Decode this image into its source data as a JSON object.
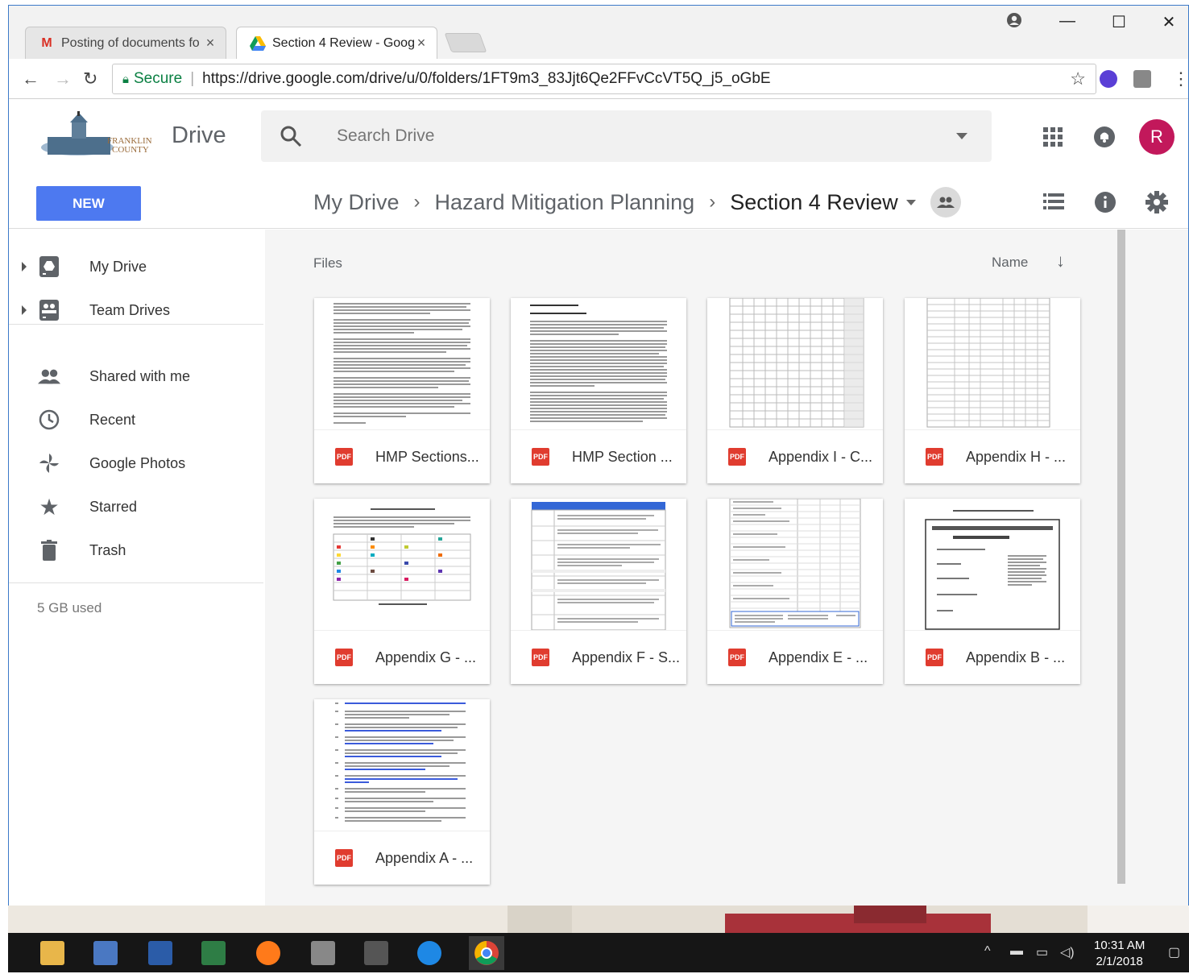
{
  "browser": {
    "tabs": [
      {
        "title": "Posting of documents fo",
        "icon": "gmail-icon"
      },
      {
        "title": "Section 4 Review - Goog",
        "icon": "google-drive-icon"
      }
    ],
    "secure_label": "Secure",
    "url": "https://drive.google.com/drive/u/0/folders/1FT9m3_83Jjt6Qe2FFvCcVT5Q_j5_oGbE"
  },
  "header": {
    "app_name": "Drive",
    "search_placeholder": "Search Drive",
    "avatar_initial": "R",
    "new_button": "NEW"
  },
  "breadcrumb": {
    "items": [
      "My Drive",
      "Hazard Mitigation Planning"
    ],
    "current": "Section 4 Review"
  },
  "sidebar": {
    "items": [
      {
        "label": "My Drive",
        "icon": "my-drive-icon"
      },
      {
        "label": "Team Drives",
        "icon": "team-drives-icon"
      },
      {
        "label": "Shared with me",
        "icon": "people-icon"
      },
      {
        "label": "Recent",
        "icon": "clock-icon"
      },
      {
        "label": "Google Photos",
        "icon": "pinwheel-icon"
      },
      {
        "label": "Starred",
        "icon": "star-icon"
      },
      {
        "label": "Trash",
        "icon": "trash-icon"
      }
    ],
    "storage": "5 GB used"
  },
  "main": {
    "section_title": "Files",
    "sort_label": "Name",
    "files": [
      {
        "name": "HMP Sections...",
        "type": "PDF"
      },
      {
        "name": "HMP Section ...",
        "type": "PDF"
      },
      {
        "name": "Appendix I - C...",
        "type": "PDF"
      },
      {
        "name": "Appendix H - ...",
        "type": "PDF"
      },
      {
        "name": "Appendix G - ...",
        "type": "PDF"
      },
      {
        "name": "Appendix F - S...",
        "type": "PDF"
      },
      {
        "name": "Appendix E - ...",
        "type": "PDF"
      },
      {
        "name": "Appendix B - ...",
        "type": "PDF"
      },
      {
        "name": "Appendix A - ...",
        "type": "PDF"
      }
    ]
  },
  "taskbar": {
    "time": "10:31 AM",
    "date": "2/1/2018"
  },
  "colors": {
    "new_button": "#4d79f0",
    "avatar": "#c2185b",
    "pdf": "#e03c2f",
    "secure": "#0b8043"
  }
}
